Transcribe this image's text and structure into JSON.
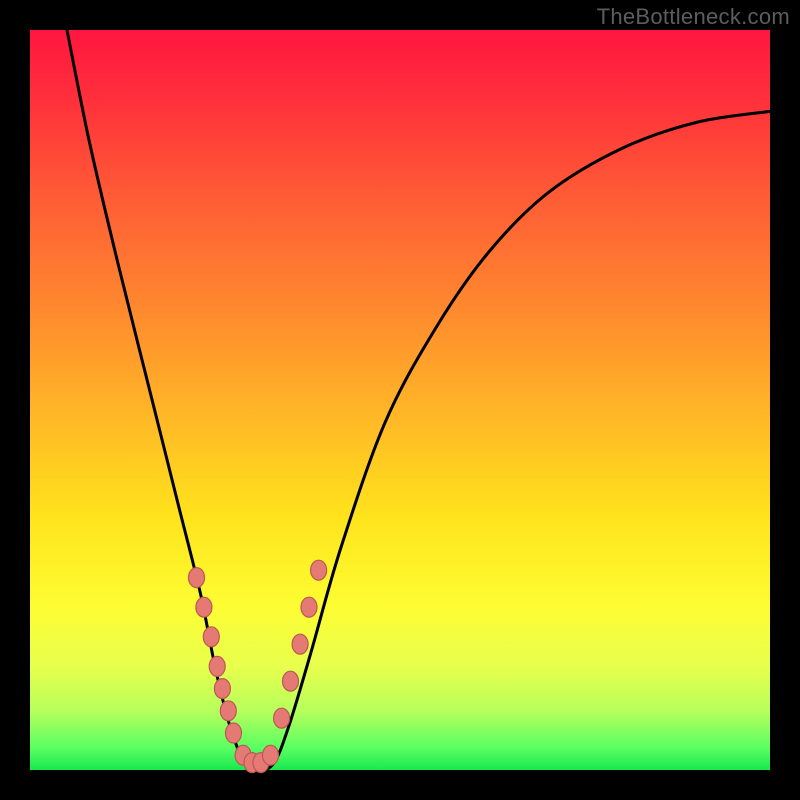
{
  "watermark": "TheBottleneck.com",
  "chart_data": {
    "type": "line",
    "title": "",
    "xlabel": "",
    "ylabel": "",
    "xlim": [
      0,
      100
    ],
    "ylim": [
      0,
      100
    ],
    "grid": false,
    "series": [
      {
        "name": "curve",
        "x": [
          5,
          8,
          12,
          16,
          20,
          23,
          25,
          27,
          29,
          31,
          33,
          35,
          38,
          42,
          48,
          55,
          62,
          70,
          80,
          90,
          100
        ],
        "y": [
          100,
          85,
          68,
          52,
          36,
          24,
          14,
          6,
          1,
          0,
          1,
          6,
          16,
          30,
          47,
          60,
          70,
          78,
          84,
          87.5,
          89
        ]
      }
    ],
    "markers": {
      "name": "dots",
      "x": [
        22.5,
        23.5,
        24.5,
        25.3,
        26.0,
        26.8,
        27.5,
        28.8,
        30.0,
        31.2,
        32.5,
        34.0,
        35.2,
        36.5,
        37.7,
        39.0
      ],
      "y": [
        26,
        22,
        18,
        14,
        11,
        8,
        5,
        2,
        1,
        1,
        2,
        7,
        12,
        17,
        22,
        27
      ]
    },
    "background_gradient": {
      "top": "#ff163f",
      "mid": "#ffe41c",
      "bottom": "#19e84f"
    }
  }
}
